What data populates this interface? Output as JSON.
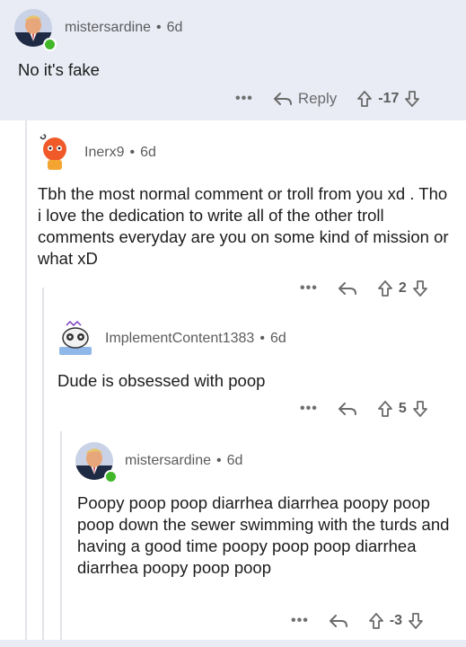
{
  "comments": [
    {
      "author": "mistersardine",
      "age": "6d",
      "text": "No it's fake",
      "reply_label": "Reply",
      "score": "-17",
      "more": "•••"
    },
    {
      "author": "Inerx9",
      "age": "6d",
      "text": "Tbh the most normal comment or troll from you xd . Tho i love the dedication to write all of the other troll comments everyday are you on some kind of mission or what xD",
      "score": "2",
      "more": "•••"
    },
    {
      "author": "ImplementContent1383",
      "age": "6d",
      "text": "Dude is obsessed with poop",
      "score": "5",
      "more": "•••"
    },
    {
      "author": "mistersardine",
      "age": "6d",
      "text": "Poopy poop poop diarrhea diarrhea poopy poop poop down the sewer swimming with the turds and having a good time poopy poop poop diarrhea diarrhea poopy poop poop",
      "score": "-3",
      "more": "•••"
    }
  ],
  "separator": "•",
  "colors": {
    "highlight": "#e9ecf5",
    "online": "#42b72a",
    "meta": "#5c5c5c"
  }
}
